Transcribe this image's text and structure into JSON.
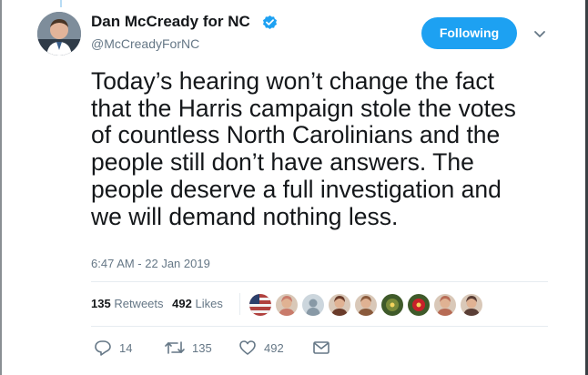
{
  "tweet": {
    "display_name": "Dan McCready for NC",
    "handle": "@McCreadyForNC",
    "verified": true,
    "text_lines": [
      "Today’s hearing won’t change the fact",
      "that the Harris campaign stole the votes",
      "of countless North Carolinians and the",
      "people still don’t have answers. The",
      "people deserve a full investigation and",
      "we will demand nothing less."
    ],
    "timestamp": "6:47 AM - 22 Jan 2019"
  },
  "follow_button": {
    "label": "Following"
  },
  "stats": {
    "retweets_count": "135",
    "retweets_label": "Retweets",
    "likes_count": "492",
    "likes_label": "Likes"
  },
  "actions": {
    "replies": "14",
    "retweets": "135",
    "likes": "492"
  },
  "likers": [
    {
      "icon": "flag-avatar-icon",
      "color": "#b0413e"
    },
    {
      "icon": "user-avatar-icon",
      "color": "#c97b6b"
    },
    {
      "icon": "default-avatar-icon",
      "color": "#aab8c2"
    },
    {
      "icon": "user-avatar-icon",
      "color": "#6a3b2a"
    },
    {
      "icon": "user-avatar-icon",
      "color": "#8a5a3c"
    },
    {
      "icon": "flower-avatar-icon",
      "color": "#7a8a3a"
    },
    {
      "icon": "flower-avatar-icon",
      "color": "#c8202a"
    },
    {
      "icon": "user-avatar-icon",
      "color": "#b76b55"
    },
    {
      "icon": "user-avatar-icon",
      "color": "#5a3e36"
    }
  ],
  "colors": {
    "accent": "#1da1f2",
    "secondary_text": "#657786",
    "primary_text": "#14171a"
  }
}
